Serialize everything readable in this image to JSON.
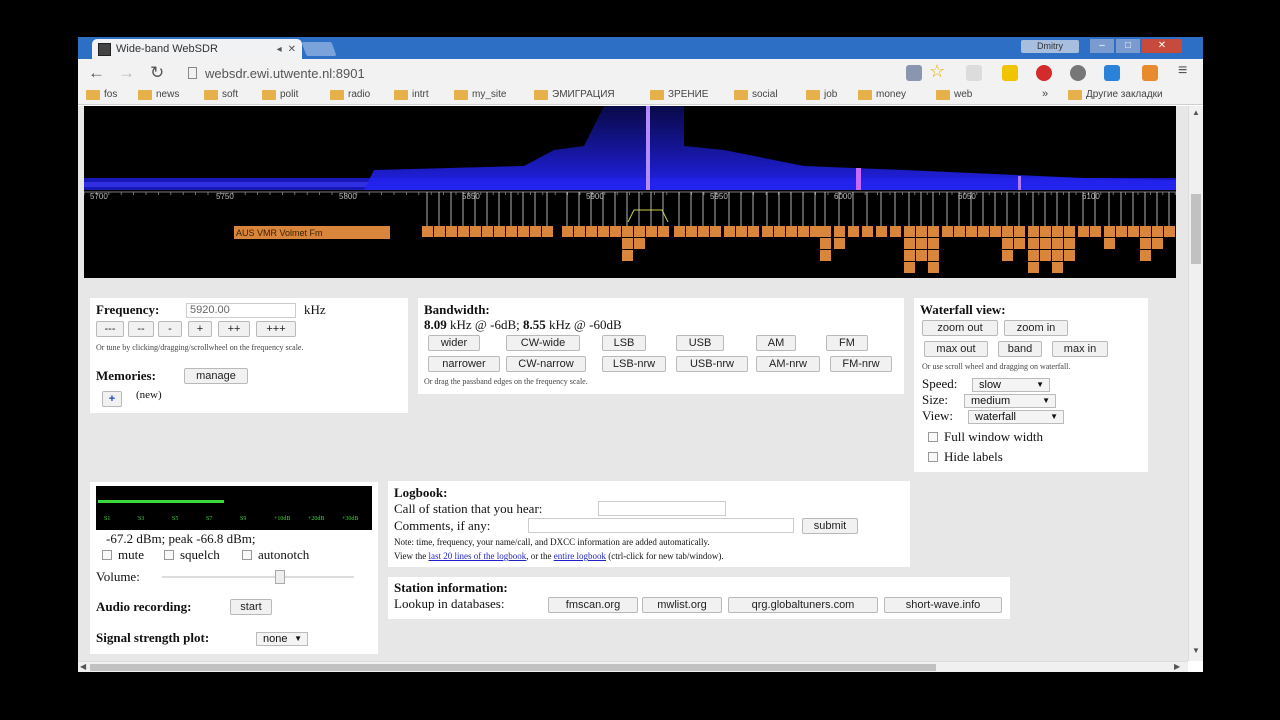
{
  "browser": {
    "tab_title": "Wide-band WebSDR",
    "tab_icons": [
      "back-arrow-icon",
      "close-icon"
    ],
    "user_button": "Dmitry",
    "url": "websdr.ewi.utwente.nl:8901",
    "bookmarks": [
      "fos",
      "news",
      "soft",
      "polit",
      "radio",
      "intrt",
      "my_site",
      "ЭМИГРАЦИЯ",
      "ЗРЕНИЕ",
      "social",
      "job",
      "money",
      "web"
    ],
    "other_bookmarks": "Другие закладки",
    "more_glyph": "»"
  },
  "waterfall": {
    "scale_labels": [
      "5700",
      "5750",
      "5800",
      "5850",
      "5900",
      "5950",
      "6000",
      "6050",
      "6100"
    ],
    "wide_label": "AUS VMR Volmet Fm"
  },
  "frequency": {
    "label": "Frequency:",
    "value": "5920.00",
    "unit": "kHz",
    "step_buttons": [
      "---",
      "--",
      "-",
      "+",
      "++",
      "+++"
    ],
    "hint": "Or tune by clicking/dragging/scrollwheel on the frequency scale."
  },
  "memories": {
    "label": "Memories:",
    "manage": "manage",
    "add": "+",
    "new_item": "(new)"
  },
  "bandwidth": {
    "label": "Bandwidth:",
    "value_6db": "8.09",
    "text_6db": "kHz @ -6dB;",
    "value_60db": "8.55",
    "text_60db": "kHz @ -60dB",
    "row1": [
      "wider",
      "CW-wide",
      "LSB",
      "USB",
      "AM",
      "FM"
    ],
    "row2": [
      "narrower",
      "CW-narrow",
      "LSB-nrw",
      "USB-nrw",
      "AM-nrw",
      "FM-nrw"
    ],
    "hint": "Or drag the passband edges on the frequency scale."
  },
  "waterfall_view": {
    "label": "Waterfall view:",
    "zoom_out": "zoom out",
    "zoom_in": "zoom in",
    "max_out": "max out",
    "band": "band",
    "max_in": "max in",
    "hint": "Or use scroll wheel and dragging on waterfall.",
    "speed_label": "Speed:",
    "speed_value": "slow",
    "size_label": "Size:",
    "size_value": "medium",
    "view_label": "View:",
    "view_value": "waterfall",
    "full_window": "Full window width",
    "hide_labels": "Hide labels"
  },
  "smeter": {
    "scale": [
      "S1",
      "S3",
      "S5",
      "S7",
      "S9",
      "+10dB",
      "+20dB",
      "+30dB"
    ],
    "reading": "-67.2 dBm; peak  -66.8 dBm;",
    "mute": "mute",
    "squelch": "squelch",
    "autonotch": "autonotch",
    "volume_label": "Volume:",
    "volume_level": 0.62
  },
  "audio_recording": {
    "label": "Audio recording:",
    "start": "start"
  },
  "signal_plot": {
    "label": "Signal strength plot:",
    "value": "none"
  },
  "logbook": {
    "label": "Logbook:",
    "call_label": "Call of station that you hear:",
    "comments_label": "Comments, if any:",
    "submit": "submit",
    "note": "Note: time, frequency, your name/call, and DXCC information are added automatically.",
    "view_prefix": "View the",
    "link_last": "last 20 lines of the logbook",
    "view_mid": ", or the",
    "link_entire": "entire logbook",
    "view_suffix": "(ctrl-click for new tab/window)."
  },
  "station_info": {
    "label": "Station information:",
    "lookup_label": "Lookup in databases:",
    "databases": [
      "fmscan.org",
      "mwlist.org",
      "qrg.globaltuners.com",
      "short-wave.info"
    ]
  },
  "colors": {
    "titlebar": "#2d6fc4",
    "label_orange": "#d9853b",
    "waterfall_blue": "#1a1ad0",
    "smeter_green": "#3ad83a"
  }
}
